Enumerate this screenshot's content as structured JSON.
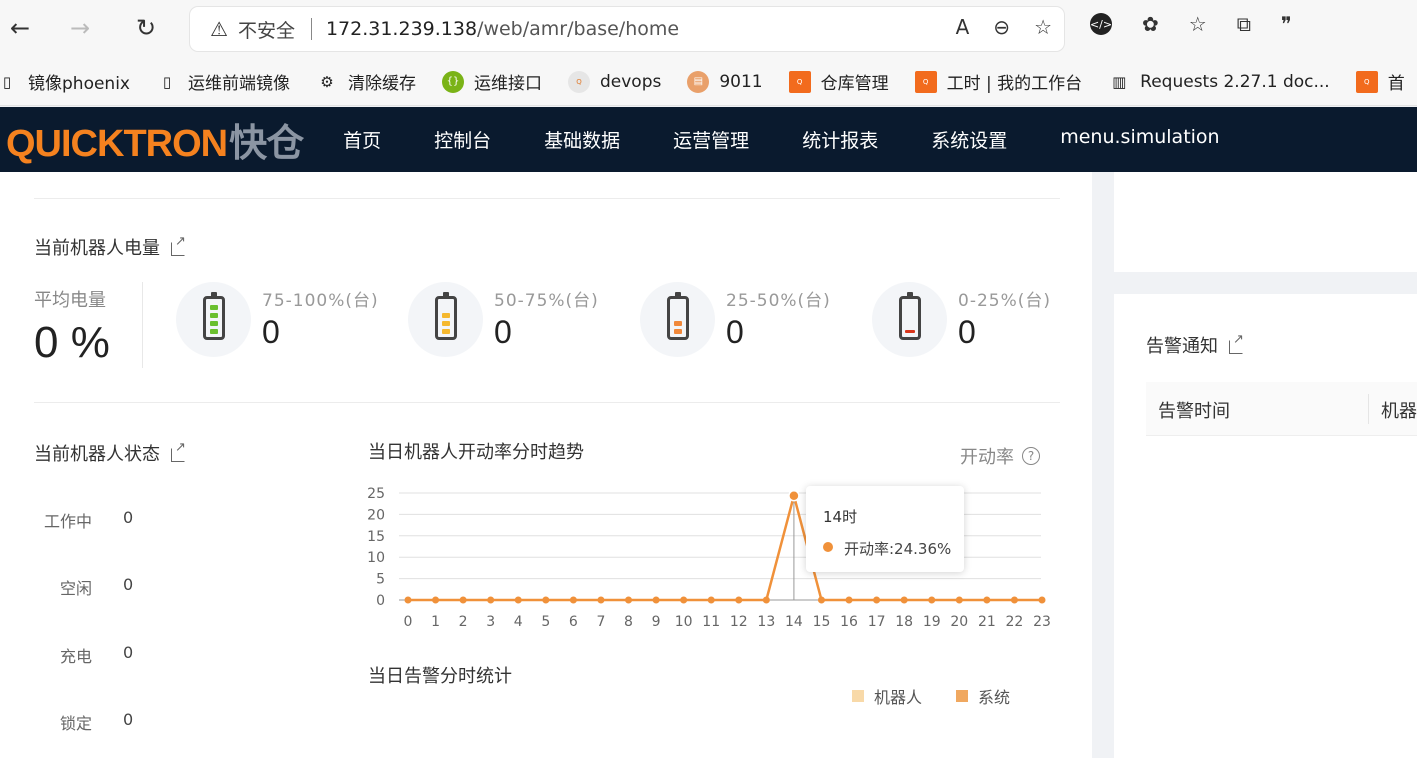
{
  "browser": {
    "security_label": "不安全",
    "url_host": "172.31.239.138",
    "url_path": "/web/amr/base/home",
    "bookmarks": [
      {
        "label": "镜像phoenix",
        "icon": "file-icon"
      },
      {
        "label": "运维前端镜像",
        "icon": "file-icon"
      },
      {
        "label": "清除缓存",
        "icon": "gear-icon"
      },
      {
        "label": "运维接口",
        "icon": "api-icon"
      },
      {
        "label": "devops",
        "icon": "quicktron-icon"
      },
      {
        "label": "9011",
        "icon": "doc-icon"
      },
      {
        "label": "仓库管理",
        "icon": "quicktron-icon"
      },
      {
        "label": "工时 | 我的工作台",
        "icon": "quicktron-icon"
      },
      {
        "label": "Requests 2.27.1 doc...",
        "icon": "book-icon"
      },
      {
        "label": "首",
        "icon": "quicktron-icon"
      }
    ]
  },
  "app": {
    "logo_text": "QUICKTRON",
    "logo_cn": "快仓",
    "menu": [
      "首页",
      "控制台",
      "基础数据",
      "运营管理",
      "统计报表",
      "系统设置",
      "menu.simulation"
    ]
  },
  "power": {
    "title": "当前机器人电量",
    "avg_label": "平均电量",
    "avg_value": "0 %",
    "groups": [
      {
        "range": "75-100%(台)",
        "count": "0",
        "color": "#6abf2e",
        "level": "high"
      },
      {
        "range": "50-75%(台)",
        "count": "0",
        "color": "#f5b82e",
        "level": "medium"
      },
      {
        "range": "25-50%(台)",
        "count": "0",
        "color": "#f0883a",
        "level": "low"
      },
      {
        "range": "0-25%(台)",
        "count": "0",
        "color": "#d9361c",
        "level": "critical"
      }
    ]
  },
  "status": {
    "title": "当前机器人状态",
    "rows": [
      {
        "label": "工作中",
        "value": "0"
      },
      {
        "label": "空闲",
        "value": "0"
      },
      {
        "label": "充电",
        "value": "0"
      },
      {
        "label": "锁定",
        "value": "0"
      }
    ]
  },
  "trend": {
    "title": "当日机器人开动率分时趋势",
    "rate_label": "开动率",
    "tooltip": {
      "title": "14时",
      "value": "开动率:24.36%"
    }
  },
  "alarm_stats": {
    "title": "当日告警分时统计",
    "legend": [
      {
        "name": "机器人",
        "color": "#f8d9a8"
      },
      {
        "name": "系统",
        "color": "#f0a860"
      }
    ]
  },
  "alarm_notice": {
    "title": "告警通知",
    "columns": [
      "告警时间",
      "机器"
    ]
  },
  "chart_data": {
    "type": "line",
    "title": "当日机器人开动率分时趋势",
    "xlabel": "",
    "ylabel": "",
    "x": [
      0,
      1,
      2,
      3,
      4,
      5,
      6,
      7,
      8,
      9,
      10,
      11,
      12,
      13,
      14,
      15,
      16,
      17,
      18,
      19,
      20,
      21,
      22,
      23
    ],
    "series": [
      {
        "name": "开动率",
        "values": [
          0,
          0,
          0,
          0,
          0,
          0,
          0,
          0,
          0,
          0,
          0,
          0,
          0,
          0,
          24.36,
          0,
          0,
          0,
          0,
          0,
          0,
          0,
          0,
          0
        ],
        "color": "#f0913a"
      }
    ],
    "ylim": [
      0,
      25
    ],
    "yticks": [
      0,
      5,
      10,
      15,
      20,
      25
    ],
    "grid": true,
    "highlight_x": 14
  }
}
